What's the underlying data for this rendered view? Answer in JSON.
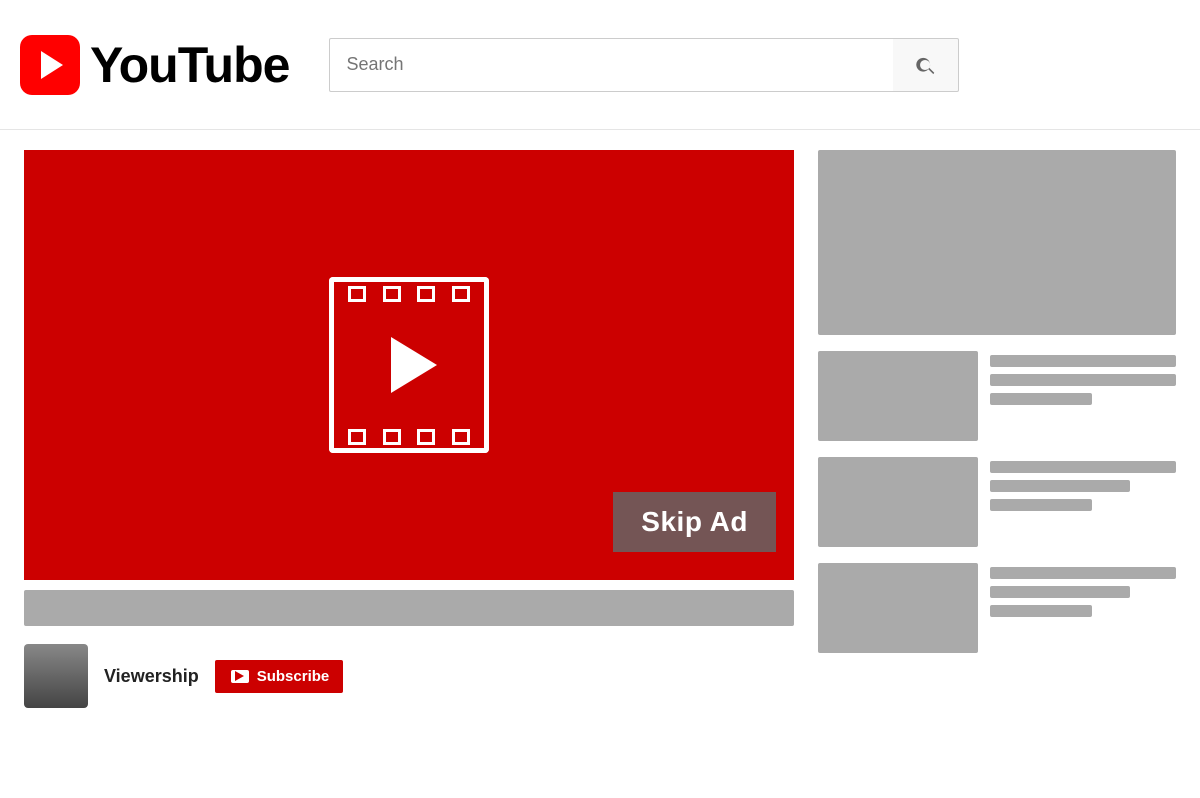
{
  "header": {
    "logo_text": "YouTube",
    "search_placeholder": "Search",
    "search_btn_label": "Search"
  },
  "video": {
    "skip_ad_label": "Skip Ad",
    "channel_name": "Viewership",
    "subscribe_label": "Subscribe"
  },
  "sidebar": {
    "cards": [
      {
        "id": 1
      },
      {
        "id": 2
      },
      {
        "id": 3
      }
    ]
  }
}
